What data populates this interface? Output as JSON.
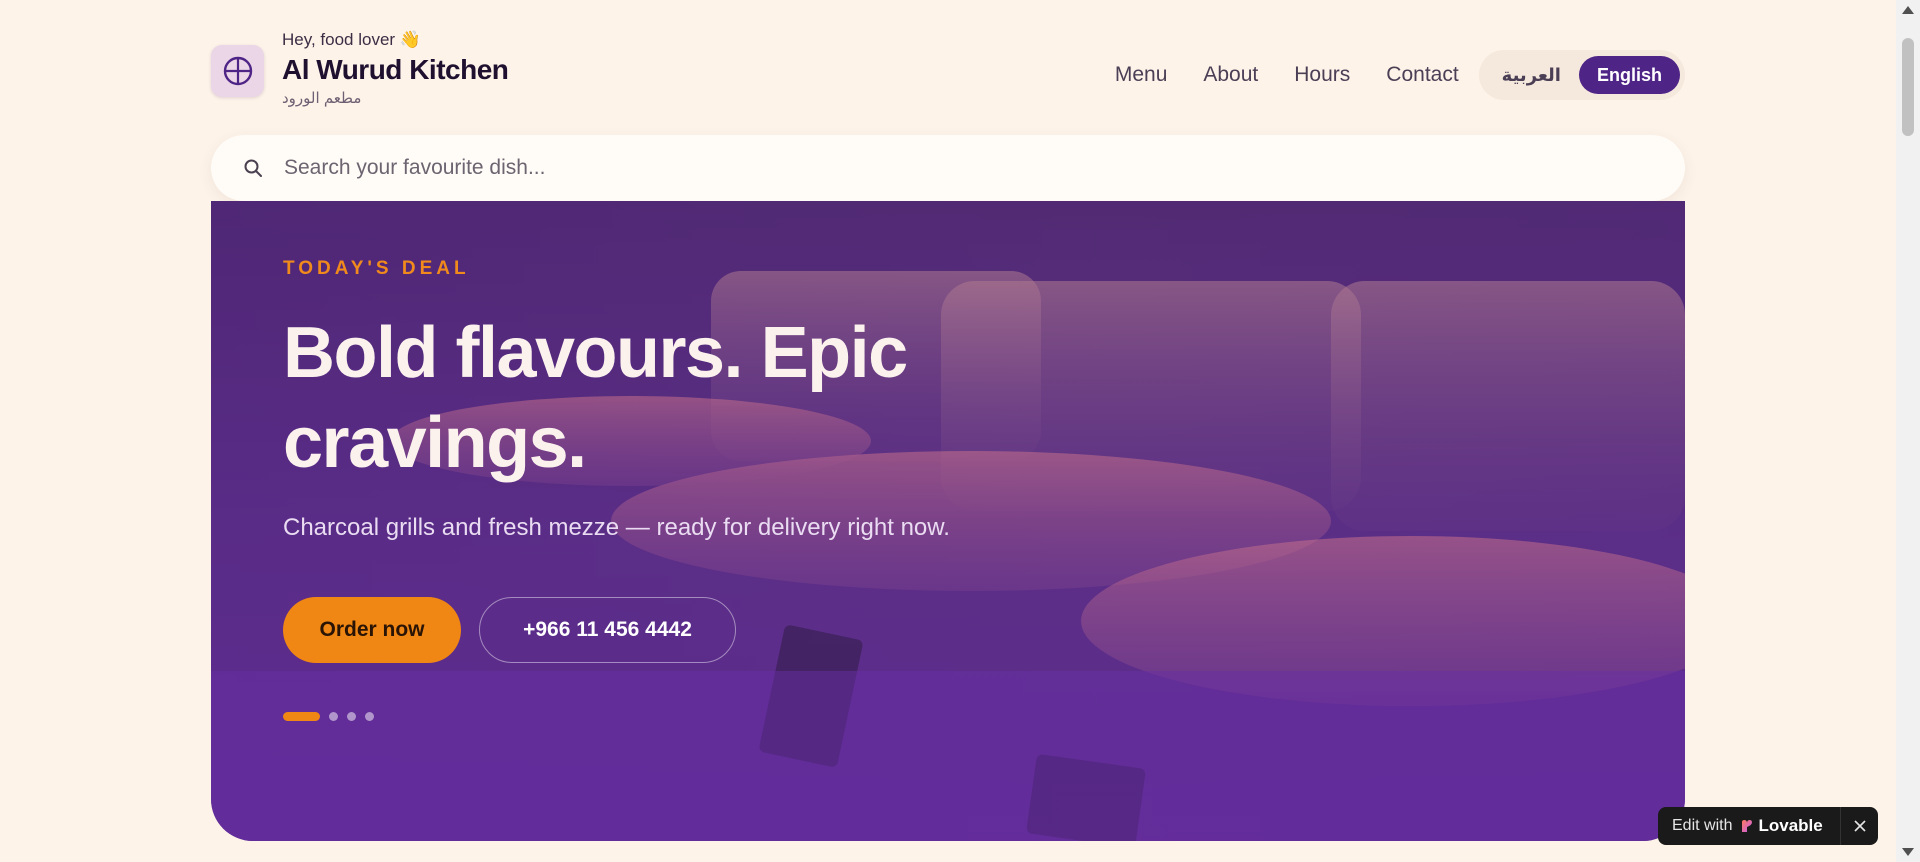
{
  "header": {
    "greeting": "Hey, food lover 👋",
    "brand_name": "Al Wurud Kitchen",
    "brand_name_ar": "مطعم الورود",
    "logo_icon": "globe-icon",
    "nav": [
      {
        "label": "Menu"
      },
      {
        "label": "About"
      },
      {
        "label": "Hours"
      },
      {
        "label": "Contact"
      }
    ],
    "languages": {
      "arabic": "العربية",
      "english": "English",
      "selected": "English"
    }
  },
  "search": {
    "placeholder": "Search your favourite dish...",
    "icon": "search-icon"
  },
  "hero": {
    "eyebrow": "TODAY'S DEAL",
    "headline": "Bold flavours. Epic cravings.",
    "subline": "Charcoal grills and fresh mezze — ready for delivery right now.",
    "primary_cta": "Order now",
    "phone_cta": "+966 11 456 4442",
    "carousel": {
      "total_slides": 4,
      "active_slide": 1
    }
  },
  "badge": {
    "prefix": "Edit with",
    "brand": "Lovable"
  },
  "colors": {
    "accent_orange": "#f08613",
    "brand_purple": "#4f2487",
    "page_bg": "#fdf3e9"
  }
}
